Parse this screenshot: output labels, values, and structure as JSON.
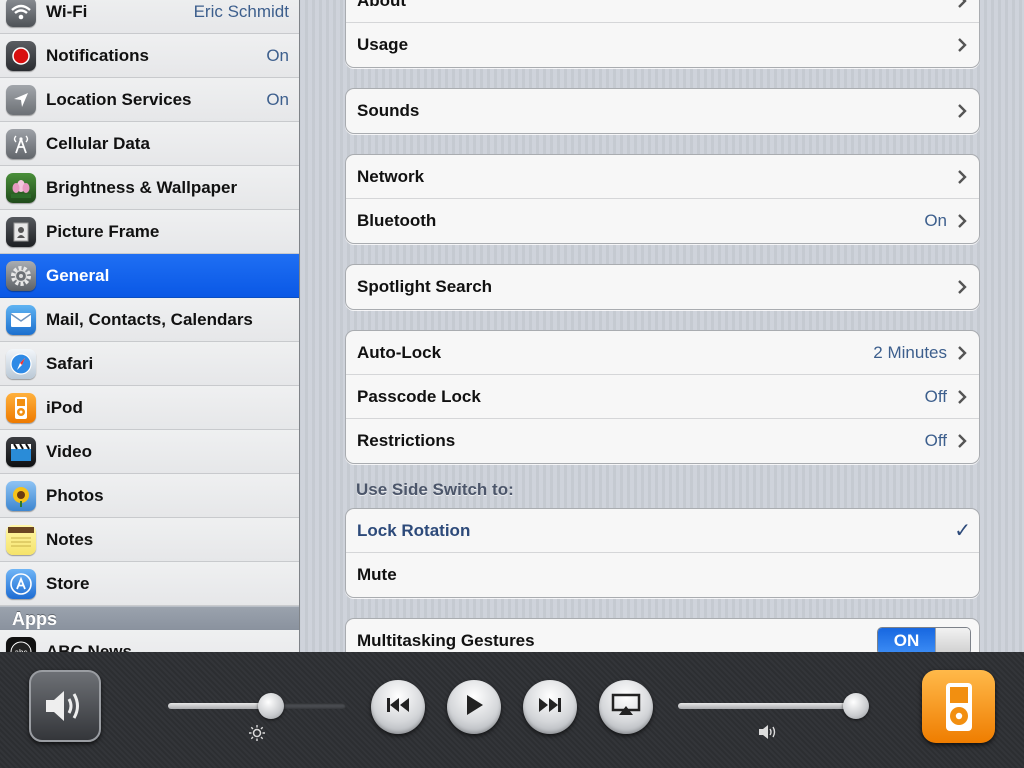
{
  "sidebar": {
    "items": [
      {
        "label": "Wi-Fi",
        "value": "Eric Schmidt",
        "icon": "wifi-icon"
      },
      {
        "label": "Notifications",
        "value": "On",
        "icon": "notifications-icon"
      },
      {
        "label": "Location Services",
        "value": "On",
        "icon": "location-icon"
      },
      {
        "label": "Cellular Data",
        "value": "",
        "icon": "cellular-icon"
      },
      {
        "label": "Brightness & Wallpaper",
        "value": "",
        "icon": "wallpaper-icon"
      },
      {
        "label": "Picture Frame",
        "value": "",
        "icon": "picture-frame-icon"
      },
      {
        "label": "General",
        "value": "",
        "icon": "gear-icon"
      },
      {
        "label": "Mail, Contacts, Calendars",
        "value": "",
        "icon": "mail-icon"
      },
      {
        "label": "Safari",
        "value": "",
        "icon": "safari-compass-icon"
      },
      {
        "label": "iPod",
        "value": "",
        "icon": "ipod-icon"
      },
      {
        "label": "Video",
        "value": "",
        "icon": "clapperboard-icon"
      },
      {
        "label": "Photos",
        "value": "",
        "icon": "sunflower-icon"
      },
      {
        "label": "Notes",
        "value": "",
        "icon": "notes-icon"
      },
      {
        "label": "Store",
        "value": "",
        "icon": "app-store-icon"
      }
    ],
    "apps_header": "Apps",
    "apps": [
      {
        "label": "ABC News",
        "icon": "abc-icon"
      }
    ]
  },
  "main": {
    "group1": [
      {
        "label": "About",
        "value": ""
      },
      {
        "label": "Usage",
        "value": ""
      }
    ],
    "group2": [
      {
        "label": "Sounds",
        "value": ""
      }
    ],
    "group3": [
      {
        "label": "Network",
        "value": ""
      },
      {
        "label": "Bluetooth",
        "value": "On"
      }
    ],
    "group4": [
      {
        "label": "Spotlight Search",
        "value": ""
      }
    ],
    "group5": [
      {
        "label": "Auto-Lock",
        "value": "2 Minutes"
      },
      {
        "label": "Passcode Lock",
        "value": "Off"
      },
      {
        "label": "Restrictions",
        "value": "Off"
      }
    ],
    "side_switch_title": "Use Side Switch to:",
    "side_switch": [
      {
        "label": "Lock Rotation",
        "checked": true
      },
      {
        "label": "Mute",
        "checked": false
      }
    ],
    "multitasking": {
      "label": "Multitasking Gestures",
      "toggle": "ON"
    }
  },
  "tray": {
    "brightness_level": 0.58,
    "volume_level": 0.99,
    "icons": [
      "speaker-lock-icon",
      "brightness-icon",
      "previous-track-icon",
      "play-icon",
      "next-track-icon",
      "airplay-icon",
      "volume-icon",
      "ipod-app-icon"
    ]
  },
  "colors": {
    "selected": "#0a58e6",
    "value_text": "#3d5f8d",
    "toggle_on": "#1767e0"
  }
}
